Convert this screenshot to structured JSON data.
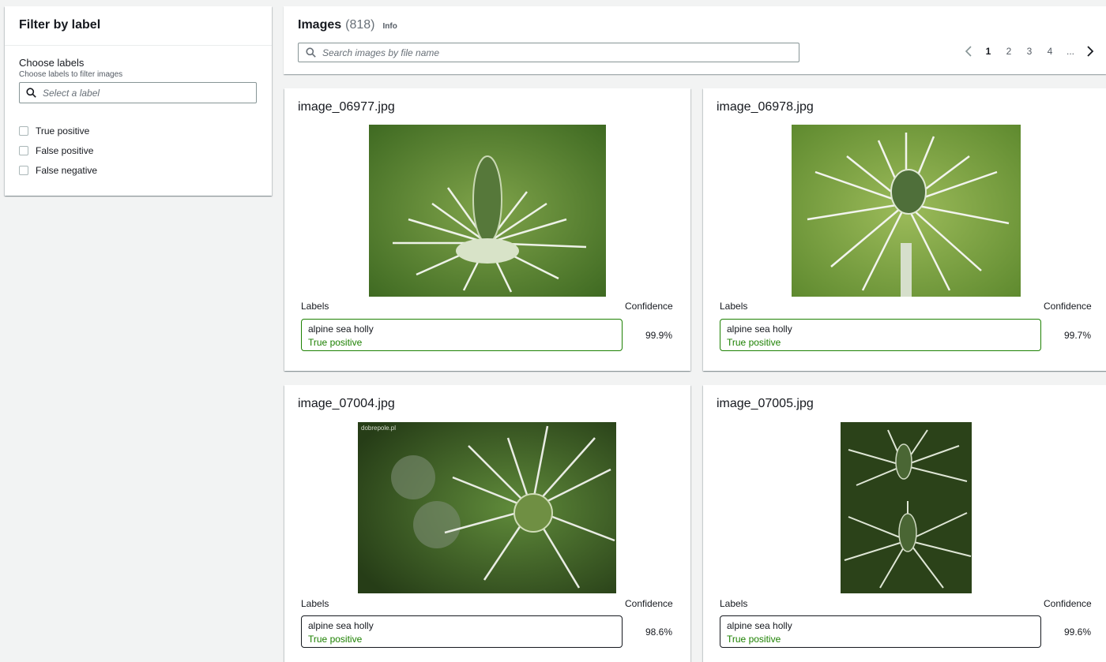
{
  "filter": {
    "title": "Filter by label",
    "choose_label": "Choose labels",
    "choose_desc": "Choose labels to filter images",
    "select_placeholder": "Select a label",
    "options": [
      "True positive",
      "False positive",
      "False negative"
    ]
  },
  "images_header": {
    "title": "Images",
    "count": "(818)",
    "info": "Info",
    "search_placeholder": "Search images by file name",
    "pages": [
      "1",
      "2",
      "3",
      "4",
      "..."
    ],
    "current_page": "1"
  },
  "cards": [
    {
      "filename": "image_06977.jpg",
      "labels_header": "Labels",
      "confidence_header": "Confidence",
      "label": "alpine sea holly",
      "result": "True positive",
      "confidence": "99.9%"
    },
    {
      "filename": "image_06978.jpg",
      "labels_header": "Labels",
      "confidence_header": "Confidence",
      "label": "alpine sea holly",
      "result": "True positive",
      "confidence": "99.7%"
    },
    {
      "filename": "image_07004.jpg",
      "labels_header": "Labels",
      "confidence_header": "Confidence",
      "label": "alpine sea holly",
      "result": "True positive",
      "confidence": "98.6%",
      "watermark": "dobrepole.pl"
    },
    {
      "filename": "image_07005.jpg",
      "labels_header": "Labels",
      "confidence_header": "Confidence",
      "label": "alpine sea holly",
      "result": "True positive",
      "confidence": "99.6%"
    }
  ],
  "colors": {
    "accent_green": "#1d8102",
    "text": "#16191f",
    "muted": "#687078",
    "background": "#f2f3f3"
  }
}
